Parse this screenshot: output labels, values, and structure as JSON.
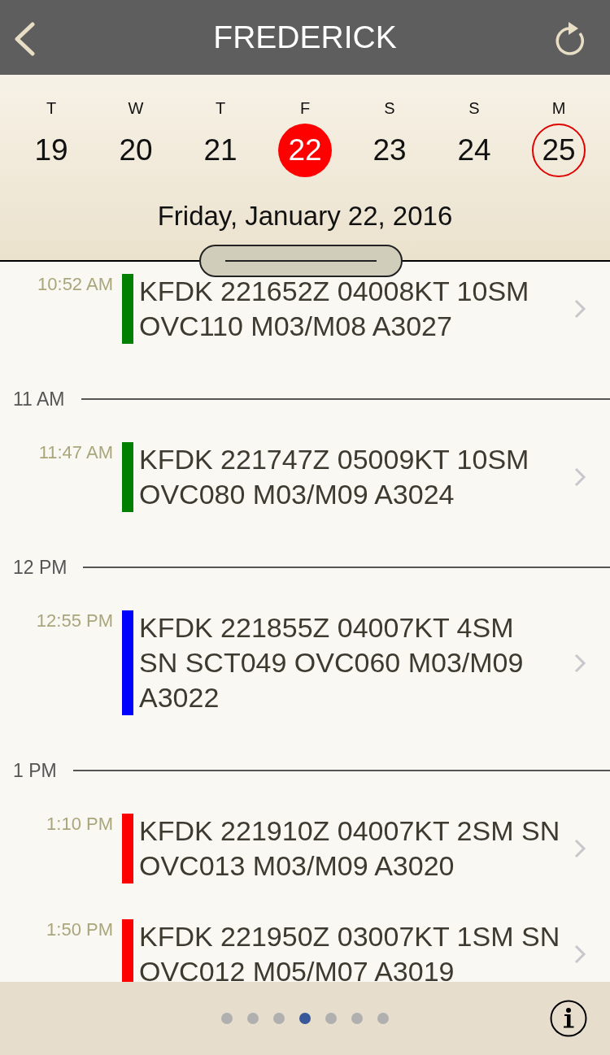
{
  "header": {
    "title": "FREDERICK"
  },
  "week": {
    "days": [
      {
        "weekday": "T",
        "day": "19",
        "selected": false,
        "today": false
      },
      {
        "weekday": "W",
        "day": "20",
        "selected": false,
        "today": false
      },
      {
        "weekday": "T",
        "day": "21",
        "selected": false,
        "today": false
      },
      {
        "weekday": "F",
        "day": "22",
        "selected": true,
        "today": false
      },
      {
        "weekday": "S",
        "day": "23",
        "selected": false,
        "today": false
      },
      {
        "weekday": "S",
        "day": "24",
        "selected": false,
        "today": false
      },
      {
        "weekday": "M",
        "day": "25",
        "selected": false,
        "today": true
      }
    ],
    "date_heading": "Friday, January 22, 2016"
  },
  "timeline": [
    {
      "kind": "observation",
      "time": "10:52 AM",
      "report": "KFDK 221652Z 04008KT 10SM\nOVC110 M03/M08 A3027",
      "color": "#008000"
    },
    {
      "kind": "hour",
      "label": "11 AM"
    },
    {
      "kind": "observation",
      "time": "11:47 AM",
      "report": "KFDK 221747Z 05009KT 10SM\nOVC080 M03/M09 A3024",
      "color": "#008000"
    },
    {
      "kind": "hour",
      "label": "12 PM"
    },
    {
      "kind": "observation",
      "time": "12:55 PM",
      "report": "KFDK 221855Z 04007KT 4SM\nSN SCT049 OVC060 M03/M09\nA3022",
      "color": "#0000ff"
    },
    {
      "kind": "hour",
      "label": "1 PM"
    },
    {
      "kind": "observation",
      "time": "1:10 PM",
      "report": "KFDK 221910Z 04007KT 2SM SN\nOVC013 M03/M09 A3020",
      "color": "#ff0000"
    },
    {
      "kind": "observation",
      "time": "1:50 PM",
      "report": "KFDK 221950Z 03007KT 1SM SN\nOVC012 M05/M07 A3019",
      "color": "#ff0000"
    }
  ],
  "pages": [
    {
      "selected": false
    },
    {
      "selected": false
    },
    {
      "selected": false
    },
    {
      "selected": true
    },
    {
      "selected": false
    },
    {
      "selected": false
    },
    {
      "selected": false
    }
  ]
}
